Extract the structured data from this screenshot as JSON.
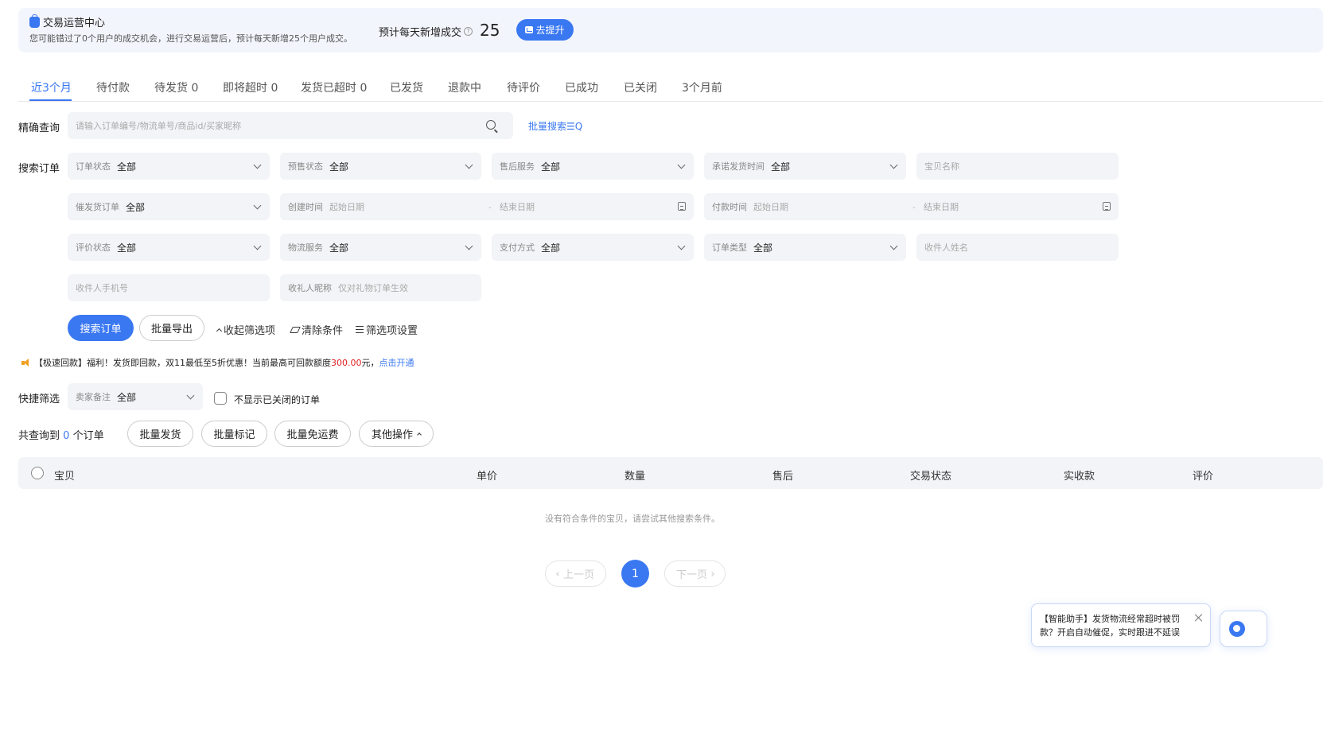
{
  "banner": {
    "title": "交易运营中心",
    "description": "您可能错过了0个用户的成交机会，进行交易运营后，预计每天新增25个用户成交。",
    "predict_label": "预计每天新增成交",
    "predict_value": "25",
    "promote_label": "去提升"
  },
  "tabs": [
    {
      "label": "近3个月",
      "active": true
    },
    {
      "label": "待付款"
    },
    {
      "label": "待发货 0"
    },
    {
      "label": "即将超时 0"
    },
    {
      "label": "发货已超时 0"
    },
    {
      "label": "已发货"
    },
    {
      "label": "退款中"
    },
    {
      "label": "待评价"
    },
    {
      "label": "已成功"
    },
    {
      "label": "已关闭"
    },
    {
      "label": "3个月前"
    }
  ],
  "precise_search": {
    "label": "精确查询",
    "placeholder": "请输入订单编号/物流单号/商品id/买家昵称",
    "batch_search": "批量搜索☰Q"
  },
  "filters": {
    "label": "搜索订单",
    "order_status": {
      "label": "订单状态",
      "value": "全部"
    },
    "presale_status": {
      "label": "预售状态",
      "value": "全部"
    },
    "after_sale": {
      "label": "售后服务",
      "value": "全部"
    },
    "promise_ship_time": {
      "label": "承诺发货时间",
      "value": "全部"
    },
    "item_name": {
      "placeholder": "宝贝名称"
    },
    "urge_ship": {
      "label": "催发货订单",
      "value": "全部"
    },
    "create_time": {
      "label": "创建时间",
      "start": "起始日期",
      "end": "结束日期"
    },
    "pay_time": {
      "label": "付款时间",
      "start": "起始日期",
      "end": "结束日期"
    },
    "review_status": {
      "label": "评价状态",
      "value": "全部"
    },
    "logistics": {
      "label": "物流服务",
      "value": "全部"
    },
    "pay_method": {
      "label": "支付方式",
      "value": "全部"
    },
    "order_type": {
      "label": "订单类型",
      "value": "全部"
    },
    "receiver_name": {
      "placeholder": "收件人姓名"
    },
    "receiver_phone": {
      "placeholder": "收件人手机号"
    },
    "gift_nick": {
      "label": "收礼人昵称",
      "placeholder": "仅对礼物订单生效"
    }
  },
  "actions": {
    "search": "搜索订单",
    "export": "批量导出",
    "collapse": "收起筛选项",
    "clear": "清除条件",
    "settings": "筛选项设置"
  },
  "notice": {
    "prefix": "【极速回款】福利！发货即回款，双11最低至5折优惠！当前最高可回款额度",
    "amount": "300.00",
    "suffix": "元，",
    "link": "点击开通"
  },
  "quick_filter": {
    "label": "快捷筛选",
    "seller_note": {
      "label": "卖家备注",
      "value": "全部"
    },
    "hide_closed": "不显示已关闭的订单"
  },
  "result": {
    "prefix": "共查询到",
    "count": "0",
    "suffix": "个订单",
    "batch_ship": "批量发货",
    "batch_mark": "批量标记",
    "batch_free_shipping": "批量免运费",
    "other_ops": "其他操作"
  },
  "table": {
    "columns": [
      "宝贝",
      "单价",
      "数量",
      "售后",
      "交易状态",
      "实收款",
      "评价"
    ],
    "empty": "没有符合条件的宝贝，请尝试其他搜索条件。"
  },
  "pagination": {
    "prev": "上一页",
    "current": "1",
    "next": "下一页"
  },
  "assistant": {
    "text": "【智能助手】发货物流经常超时被罚款？开启自动催促，实时跟进不延误"
  },
  "colors": {
    "accent": "#3a78f2",
    "amount": "#e02020",
    "notice_icon": "#f0a020"
  }
}
